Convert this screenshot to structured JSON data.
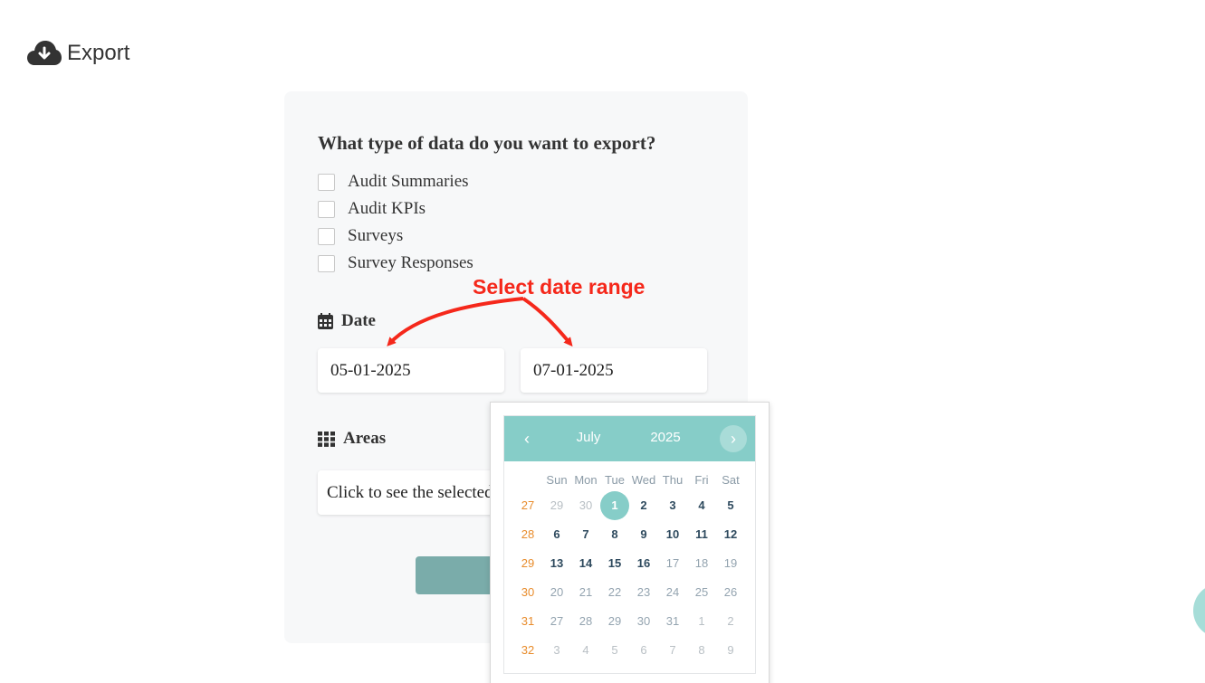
{
  "header": {
    "title": "Export",
    "icon": "cloud-download-icon"
  },
  "form": {
    "question": "What type of data do you want to export?",
    "options": [
      {
        "label": "Audit Summaries",
        "checked": false
      },
      {
        "label": "Audit KPIs",
        "checked": false
      },
      {
        "label": "Surveys",
        "checked": false
      },
      {
        "label": "Survey Responses",
        "checked": false
      }
    ],
    "date_label": "Date",
    "start_date": "05-01-2025",
    "end_date": "07-01-2025",
    "areas_label": "Areas",
    "areas_placeholder": "Click to see the selected areas"
  },
  "annotation": {
    "text": "Select date range",
    "color": "#f5281b"
  },
  "datepicker": {
    "prev": "‹",
    "next": "›",
    "month": "July",
    "year": "2025",
    "weekdays": [
      "Sun",
      "Mon",
      "Tue",
      "Wed",
      "Thu",
      "Fri",
      "Sat"
    ],
    "selected_day": "1",
    "weeks": [
      {
        "week": "27",
        "days": [
          "29",
          "30",
          "1",
          "2",
          "3",
          "4",
          "5"
        ]
      },
      {
        "week": "28",
        "days": [
          "6",
          "7",
          "8",
          "9",
          "10",
          "11",
          "12"
        ]
      },
      {
        "week": "29",
        "days": [
          "13",
          "14",
          "15",
          "16",
          "17",
          "18",
          "19"
        ]
      },
      {
        "week": "30",
        "days": [
          "20",
          "21",
          "22",
          "23",
          "24",
          "25",
          "26"
        ]
      },
      {
        "week": "31",
        "days": [
          "27",
          "28",
          "29",
          "30",
          "31",
          "1",
          "2"
        ]
      },
      {
        "week": "32",
        "days": [
          "3",
          "4",
          "5",
          "6",
          "7",
          "8",
          "9"
        ]
      }
    ]
  },
  "colors": {
    "accent": "#86cdc8",
    "button": "#7aacaa",
    "week_number": "#e88c2c"
  }
}
